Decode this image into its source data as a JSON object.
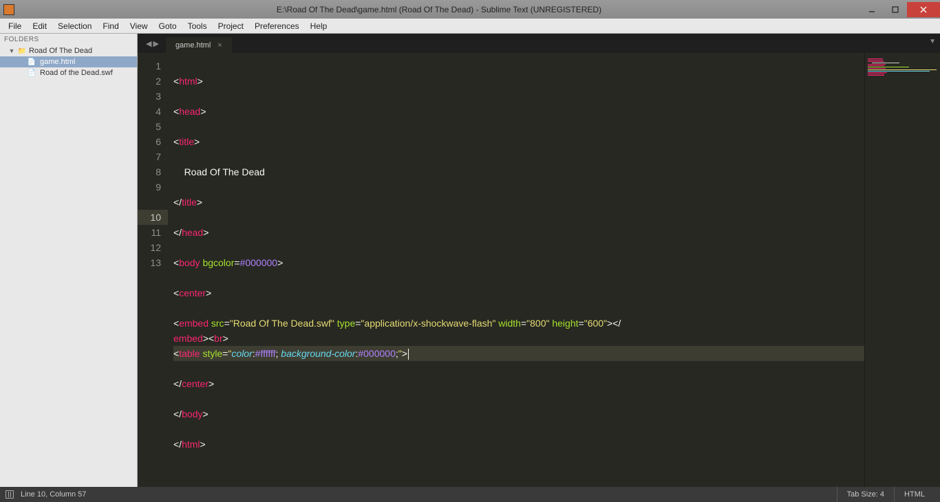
{
  "window": {
    "title": "E:\\Road Of The Dead\\game.html (Road Of The Dead) - Sublime Text (UNREGISTERED)"
  },
  "menu": [
    "File",
    "Edit",
    "Selection",
    "Find",
    "View",
    "Goto",
    "Tools",
    "Project",
    "Preferences",
    "Help"
  ],
  "sidebar": {
    "header": "FOLDERS",
    "folder": "Road Of The Dead",
    "files": [
      "game.html",
      "Road of the Dead.swf"
    ],
    "selected_index": 0
  },
  "tabs": {
    "active": "game.html"
  },
  "gutter": {
    "lines": 13,
    "current": 10
  },
  "code": {
    "l1": {
      "text": "<html>"
    },
    "l2": {
      "text": "<head>"
    },
    "l3": {
      "text": "<title>"
    },
    "l4": {
      "indent": "    ",
      "text": "Road Of The Dead"
    },
    "l5": {
      "text": "</title>"
    },
    "l6": {
      "text": "</head>"
    },
    "l7": {
      "tag": "body",
      "attr": "bgcolor",
      "val": "#000000"
    },
    "l8": {
      "text": "<center>"
    },
    "l9": {
      "tag": "embed",
      "src": "Road Of The Dead.swf",
      "type": "application/x-shockwave-flash",
      "w": "800",
      "h": "600"
    },
    "l10": {
      "tag": "table",
      "style_attr": "style",
      "p1": "color",
      "v1": "#ffffff",
      "p2": "background-color",
      "v2": "#000000"
    },
    "l11": {
      "text": "</center>"
    },
    "l12": {
      "text": "</body>"
    },
    "l13": {
      "text": "</html>"
    }
  },
  "status": {
    "pos": "Line 10, Column 57",
    "tab_size": "Tab Size: 4",
    "syntax": "HTML"
  }
}
